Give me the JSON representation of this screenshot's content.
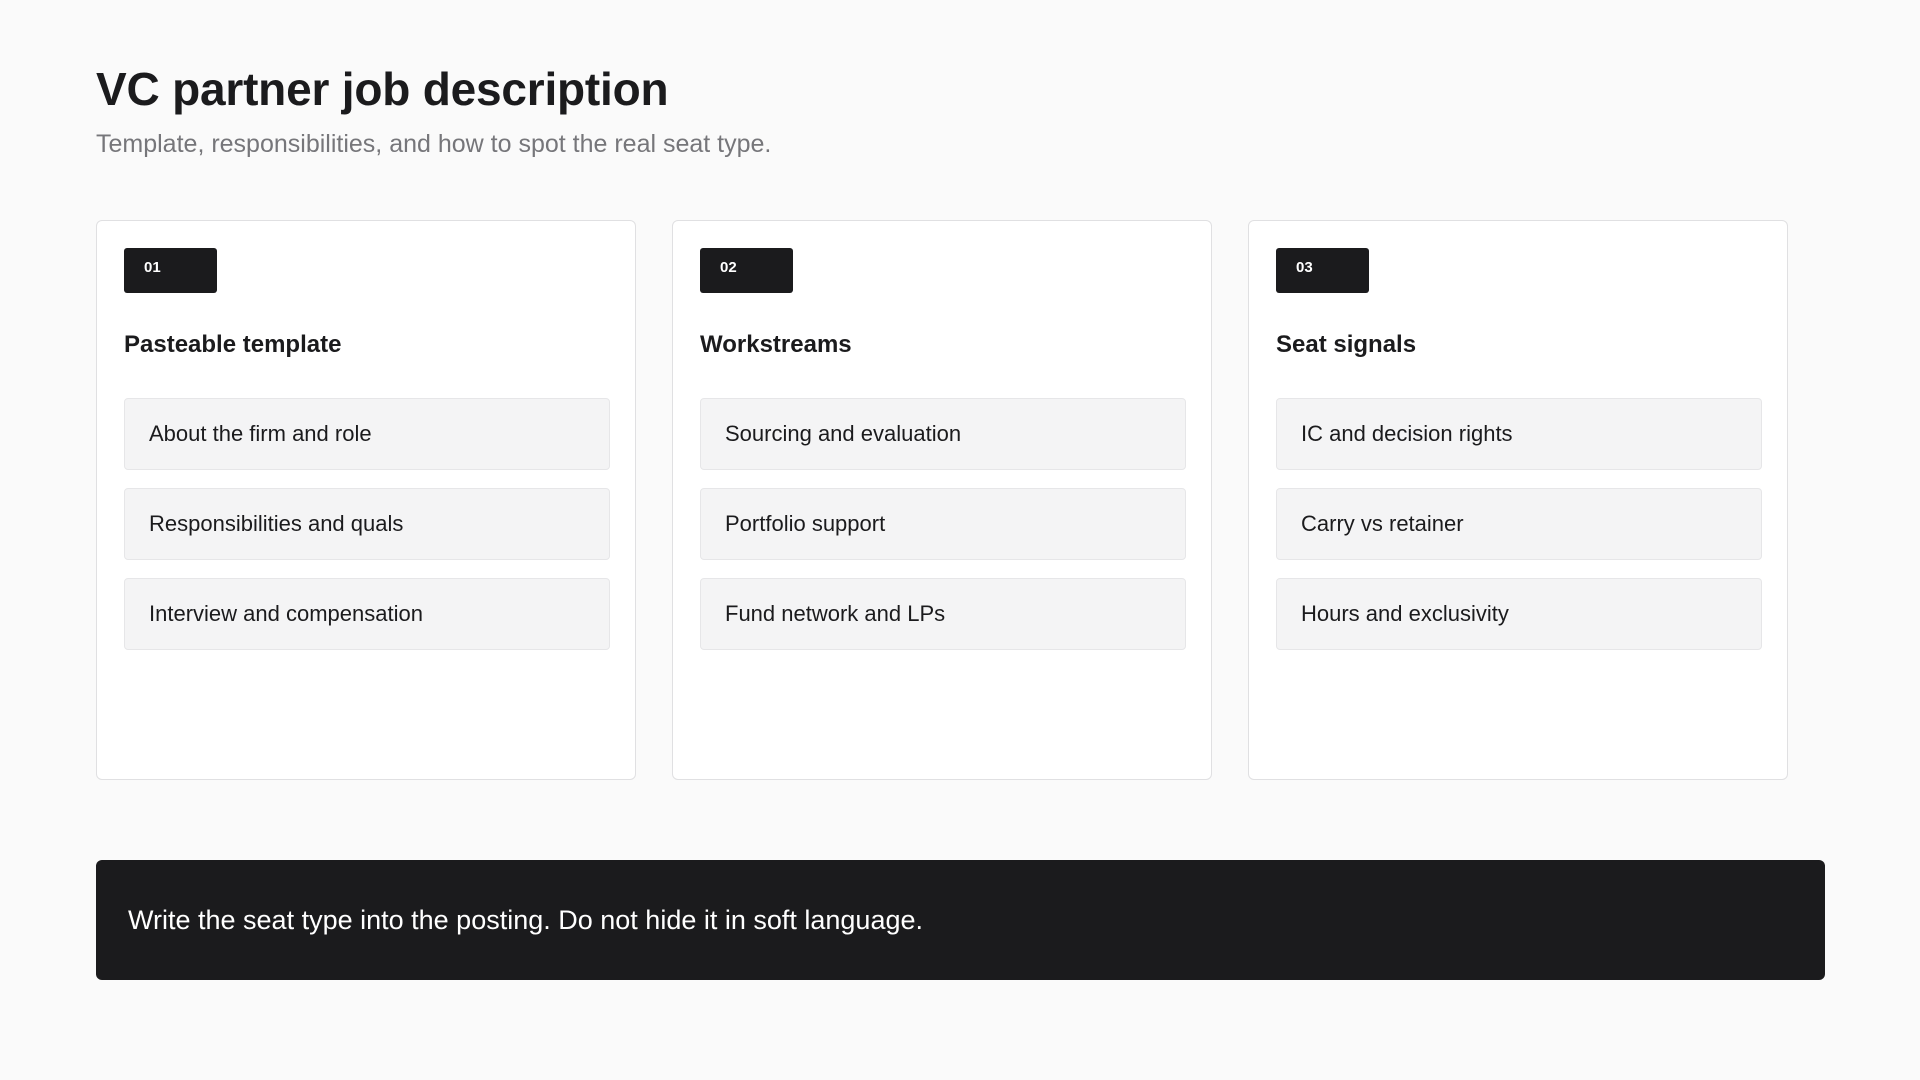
{
  "header": {
    "title": "VC partner job description",
    "subtitle": "Template, responsibilities, and how to spot the real seat type."
  },
  "cards": [
    {
      "badge": "01",
      "title": "Pasteable template",
      "items": [
        "About the firm and role",
        "Responsibilities and quals",
        "Interview and compensation"
      ]
    },
    {
      "badge": "02",
      "title": "Workstreams",
      "items": [
        "Sourcing and evaluation",
        "Portfolio support",
        "Fund network and LPs"
      ]
    },
    {
      "badge": "03",
      "title": "Seat signals",
      "items": [
        "IC and decision rights",
        "Carry vs retainer",
        "Hours and exclusivity"
      ]
    }
  ],
  "callout": {
    "text": "Write the seat type into the posting. Do not hide it in soft language."
  },
  "colors": {
    "background": "#fafafa",
    "dark": "#1b1b1d",
    "muted_text": "#76767a",
    "item_background": "#f4f4f5"
  }
}
